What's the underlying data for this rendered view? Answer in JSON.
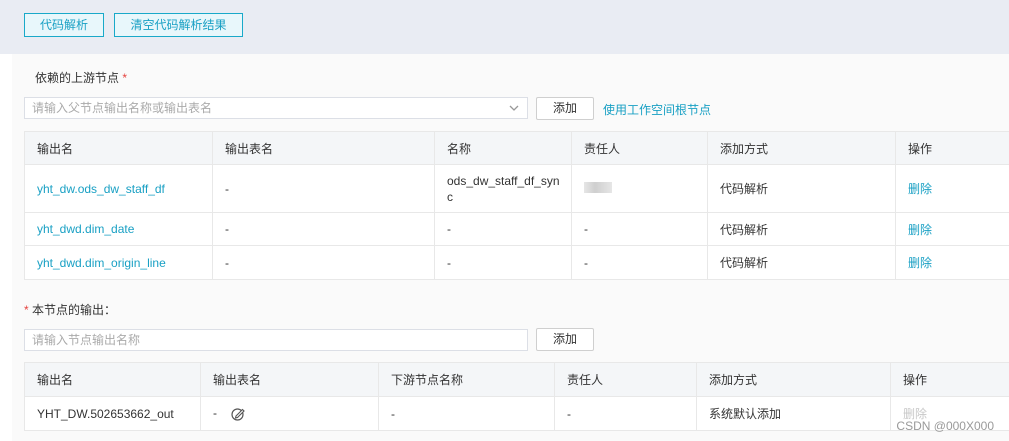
{
  "toolbar": {
    "parse_label": "代码解析",
    "clear_label": "清空代码解析结果"
  },
  "upstream": {
    "title": "依赖的上游节点",
    "required_mark": "*",
    "search_placeholder": "请输入父节点输出名称或输出表名",
    "add_label": "添加",
    "root_link": "使用工作空间根节点",
    "columns": [
      "输出名",
      "输出表名",
      "名称",
      "责任人",
      "添加方式",
      "操作"
    ],
    "rows": [
      {
        "output_name": "yht_dw.ods_dw_staff_df",
        "table_name": "-",
        "name": "ods_dw_staff_df_sync",
        "owner": "",
        "method": "代码解析",
        "action": "删除"
      },
      {
        "output_name": "yht_dwd.dim_date",
        "table_name": "-",
        "name": "-",
        "owner": "-",
        "method": "代码解析",
        "action": "删除"
      },
      {
        "output_name": "yht_dwd.dim_origin_line",
        "table_name": "-",
        "name": "-",
        "owner": "-",
        "method": "代码解析",
        "action": "删除"
      }
    ]
  },
  "output": {
    "required_mark": "*",
    "title": "本节点的输出：",
    "input_placeholder": "请输入节点输出名称",
    "add_label": "添加",
    "columns": [
      "输出名",
      "输出表名",
      "下游节点名称",
      "责任人",
      "添加方式",
      "操作"
    ],
    "rows": [
      {
        "output_name": "YHT_DW.502653662_out",
        "table_name": "-",
        "downstream": "-",
        "owner": "-",
        "method": "系统默认添加",
        "action": "删除"
      }
    ]
  },
  "watermark": "CSDN @000X000"
}
